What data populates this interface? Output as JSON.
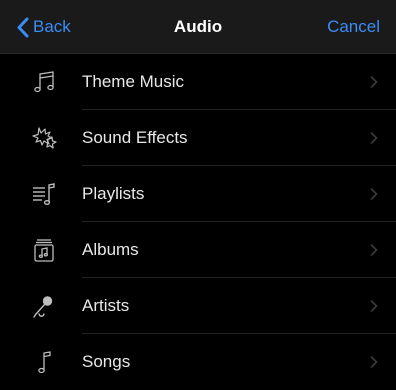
{
  "navbar": {
    "back_label": "Back",
    "title": "Audio",
    "cancel_label": "Cancel"
  },
  "items": [
    {
      "label": "Theme Music",
      "icon": "music-note-icon"
    },
    {
      "label": "Sound Effects",
      "icon": "sound-effects-icon"
    },
    {
      "label": "Playlists",
      "icon": "playlist-icon"
    },
    {
      "label": "Albums",
      "icon": "album-icon"
    },
    {
      "label": "Artists",
      "icon": "microphone-icon"
    },
    {
      "label": "Songs",
      "icon": "single-note-icon"
    }
  ],
  "colors": {
    "accent": "#3d8cf3",
    "background": "#000000",
    "navbar": "#1a1a1a",
    "text": "#e8e8e8",
    "chevron": "#3a3a3a"
  }
}
